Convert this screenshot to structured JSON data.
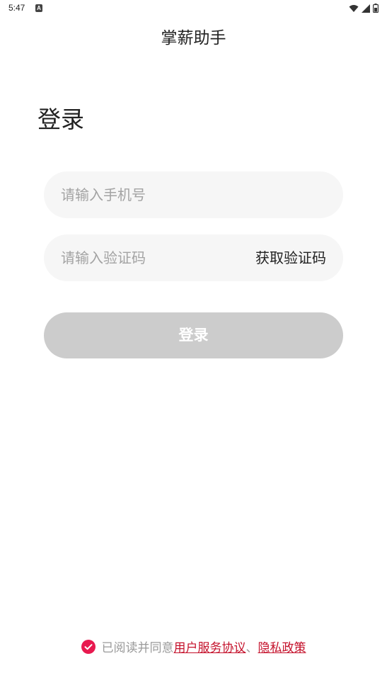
{
  "status_bar": {
    "time": "5:47",
    "notification_icon_letter": "A",
    "icons": [
      "wifi-icon",
      "signal-icon",
      "battery-icon"
    ]
  },
  "app_title": "掌薪助手",
  "page_heading": "登录",
  "phone_field": {
    "placeholder": "请输入手机号",
    "value": ""
  },
  "code_field": {
    "placeholder": "请输入验证码",
    "value": ""
  },
  "get_code_label": "获取验证码",
  "login_button_label": "登录",
  "agreement": {
    "checked": true,
    "prefix": "已阅读并同意",
    "user_agreement": "用户服务协议",
    "separator": "、",
    "privacy_policy": "隐私政策"
  },
  "colors": {
    "accent": "#e8194f",
    "link": "#c4102a",
    "button_disabled": "#cccccc",
    "field_bg": "#f6f6f6",
    "placeholder": "#a3a3a3"
  }
}
